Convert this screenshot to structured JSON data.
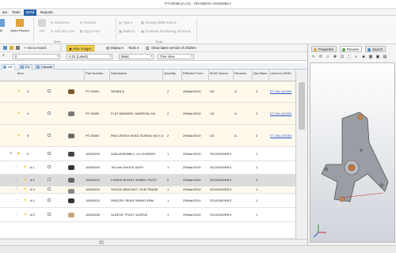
{
  "window": {
    "title": "PT-00088 [A.01] - GRABBOX ASSEMBLY"
  },
  "menu": {
    "items": [
      "ain",
      "Tools",
      "BOM",
      "Reports"
    ]
  },
  "ribbon": {
    "edit_label": "dit",
    "open_record": "Open Record",
    "add": "Add",
    "add_items": "Add Items",
    "add_text_line": "Add Text Line",
    "remove": "Remove",
    "copy_from": "Copy From",
    "type": "Type",
    "markers": "Markers",
    "change_bom_source": "Change BOM Source",
    "generate_numbering": "Generate Numbering Schemes",
    "group_main": "Main",
    "group_tools": "Tools"
  },
  "toolbar1": {
    "go_to_record": "Go to record",
    "hide_images": "Hide Images",
    "display": "Display",
    "tools": "Tools",
    "show_latest": "Show latest version of children"
  },
  "toolbar2": {
    "item_sel": "0",
    "rev_sel": "A.01 (Latest)",
    "view_sel": "Basic",
    "tree_sel": "Tree View"
  },
  "tabs": [
    "US",
    "EU",
    "Canada"
  ],
  "columns": [
    "Item",
    "Part Number",
    "Description",
    "Quantity",
    "Effective From",
    "BOM Source",
    "Revision",
    "Qty Manu",
    "Linked to BOM"
  ],
  "rows": [
    {
      "item": "3",
      "part": "PT-00091",
      "desc": "SPINDLE",
      "qty": "2",
      "eff": "29/Mar/2019",
      "src": "US",
      "rev": "A",
      "qm": "2",
      "link": "ET-SW-100253",
      "bg": "#fff9ec"
    },
    {
      "item": "4",
      "part": "PT-00092",
      "desc": "FLAT WASHER, NARROW, M4",
      "qty": "2",
      "eff": "29/Mar/2019",
      "src": "US",
      "rev": "A",
      "qm": "2",
      "link": "ET-SW-100253",
      "bg": "#fff9ec"
    },
    {
      "item": "5",
      "part": "PT-00093",
      "desc": "PAN CROSS HEAD SCREW, M4 X 8",
      "qty": "2",
      "eff": "29/Mar/2019",
      "src": "US",
      "rev": "A",
      "qm": "2",
      "link": "ET-SW-100253",
      "bg": "#fff9ec"
    },
    {
      "item": "6",
      "part": "10000239",
      "desc": "SUB ASSEMBLY, LH CHASSIS",
      "qty": "1",
      "eff": "29/Mar/2019",
      "src": "SOLIDWORKS",
      "rev": "",
      "qm": "1",
      "link": "",
      "bg": "#ffffff"
    },
    {
      "item": "6.1",
      "part": "10000018",
      "desc": "183 mm SHOCK ASSY",
      "qty": "1",
      "eff": "29/Mar/2019",
      "src": "SOLIDWORKS",
      "rev": "",
      "qm": "1",
      "link": "",
      "bg": "#ffffff"
    },
    {
      "item": "6.2",
      "part": "10000019",
      "desc": "LOWER BOGEY WHEEL PIVOT",
      "qty": "2",
      "eff": "29/Mar/2019",
      "src": "SOLIDWORKS",
      "rev": "-",
      "qm": "2",
      "link": "",
      "bg": "#dcdcdc"
    },
    {
      "item": "6.3",
      "part": "10000020",
      "desc": "SHOCK BRACKET, SUB FRAME",
      "qty": "1",
      "eff": "29/Mar/2019",
      "src": "SOLIDWORKS",
      "rev": "",
      "qm": "1",
      "link": "",
      "bg": "#fff9ec"
    },
    {
      "item": "6.4",
      "part": "10000023",
      "desc": "SPACER, REAR SWING ARM",
      "qty": "1",
      "eff": "29/Mar/2019",
      "src": "SOLIDWORKS",
      "rev": "",
      "qm": "1",
      "link": "",
      "bg": "#ffffff"
    },
    {
      "item": "6.5",
      "part": "10000035",
      "desc": "SLEEVE, PIVOT SLEEVE",
      "qty": "1",
      "eff": "29/Mar/2019",
      "src": "SOLIDWORKS",
      "rev": "",
      "qm": "1",
      "link": "",
      "bg": "#ffffff"
    },
    {
      "item": "",
      "part": "",
      "desc": "",
      "qty": "",
      "eff": "",
      "src": "",
      "rev": "",
      "qm": "",
      "link": "",
      "bg": "#ffffff"
    }
  ],
  "right_panel": {
    "tabs": [
      "Properties",
      "Preview",
      "Search"
    ]
  },
  "colors": {
    "accent": "#2b66a8",
    "link": "#2255cc",
    "selected_row": "#dcdcdc",
    "highlight_button": "#f7d34a"
  }
}
